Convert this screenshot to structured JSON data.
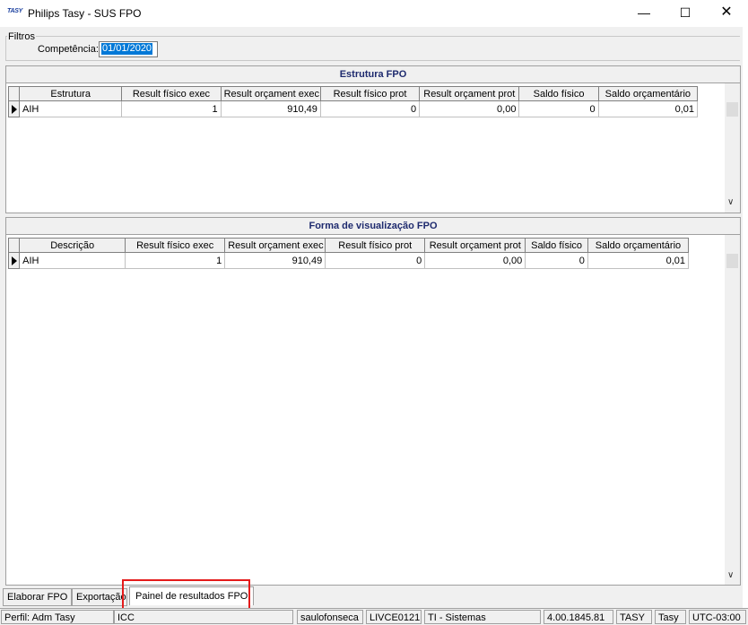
{
  "window": {
    "title": "Philips Tasy - SUS FPO",
    "app_logo": "TASY",
    "minimize_glyph": "—",
    "maximize_glyph": "☐",
    "close_glyph": "✕"
  },
  "filters": {
    "legend": "Filtros",
    "competencia_label": "Competência:",
    "competencia_value": "01/01/2020"
  },
  "estrutura": {
    "title": "Estrutura FPO",
    "columns": [
      "Estrutura",
      "Result físico exec",
      "Result orçament exec",
      "Result físico prot",
      "Result orçament prot",
      "Saldo físico",
      "Saldo orçamentário"
    ],
    "rows": [
      [
        "AIH",
        "1",
        "910,49",
        "0",
        "0,00",
        "0",
        "0,01"
      ]
    ]
  },
  "visualizacao": {
    "title": "Forma de visualização FPO",
    "columns": [
      "Descrição",
      "Result físico exec",
      "Result orçament exec",
      "Result físico prot",
      "Result orçament prot",
      "Saldo físico",
      "Saldo orçamentário"
    ],
    "rows": [
      [
        "AIH",
        "1",
        "910,49",
        "0",
        "0,00",
        "0",
        "0,01"
      ]
    ]
  },
  "tabs": [
    "Elaborar FPO",
    "Exportação",
    "Painel de resultados FPO"
  ],
  "active_tab": "Painel de resultados FPO",
  "status": {
    "perfil": "Perfil: Adm Tasy",
    "estab": "ICC",
    "user": "saulofonseca",
    "machine": "LIVCE0121",
    "sector": "TI - Sistemas",
    "version": "4.00.1845.81",
    "db": "TASY",
    "schema": "Tasy",
    "tz": "UTC-03:00"
  },
  "colors": {
    "panel_title": "#1e2a6e",
    "highlight": "#e41b1b",
    "selection": "#0078d7"
  }
}
